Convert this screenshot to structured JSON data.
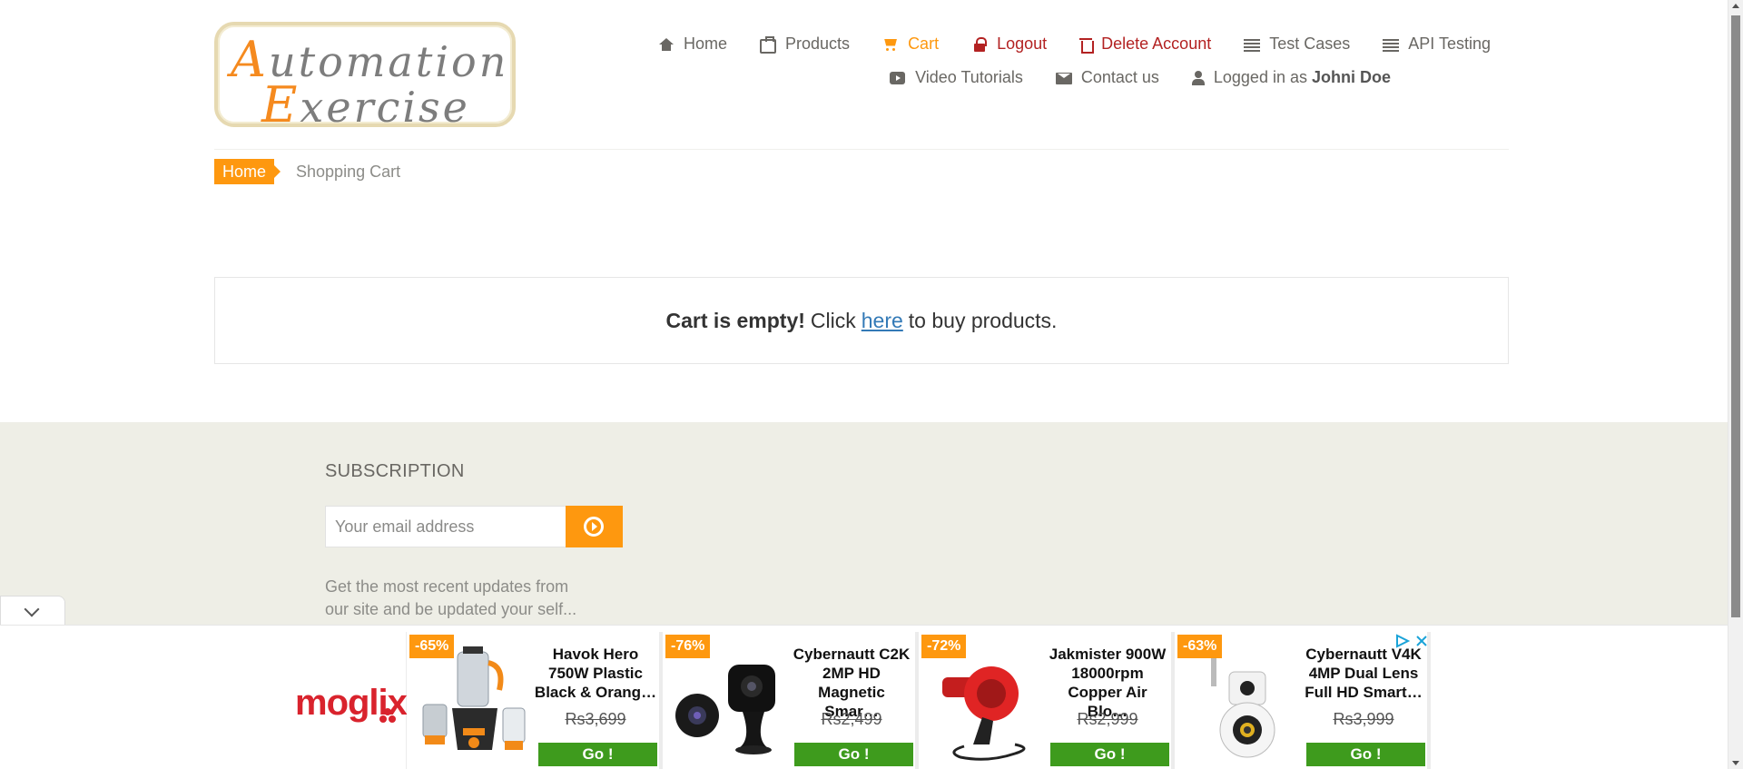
{
  "logo": {
    "line1_cap": "A",
    "line1_rest": "utomation",
    "line2_cap": "E",
    "line2_rest": "xercise"
  },
  "nav": {
    "row1": [
      {
        "label": "Home",
        "icon": "home-icon"
      },
      {
        "label": "Products",
        "icon": "briefcase-icon"
      },
      {
        "label": "Cart",
        "icon": "shopping-cart-icon"
      },
      {
        "label": "Logout",
        "icon": "lock-icon"
      },
      {
        "label": "Delete Account",
        "icon": "trash-icon"
      },
      {
        "label": "Test Cases",
        "icon": "list-icon"
      },
      {
        "label": "API Testing",
        "icon": "list-icon"
      }
    ],
    "row2": [
      {
        "label": "Video Tutorials",
        "icon": "youtube-play-icon"
      },
      {
        "label": "Contact us",
        "icon": "envelope-icon"
      },
      {
        "label": "Logged in as",
        "icon": "user-icon",
        "username": "Johni Doe"
      }
    ]
  },
  "breadcrumb": {
    "home": "Home",
    "current": "Shopping Cart"
  },
  "cart": {
    "empty_bold": "Cart is empty!",
    "click": "Click",
    "link": "here",
    "rest": "to buy products."
  },
  "subscription": {
    "title": "SUBSCRIPTION",
    "placeholder": "Your email address",
    "description": "Get the most recent updates from our site and be updated your self..."
  },
  "ad": {
    "brand": "moglix",
    "go_label": "Go !",
    "cards": [
      {
        "discount": "-65%",
        "title": "Havok Hero 750W Plastic Black & Orang…",
        "price": "Rs3,699"
      },
      {
        "discount": "-76%",
        "title": "Cybernautt C2K 2MP HD Magnetic Smar…",
        "price": "Rs2,499"
      },
      {
        "discount": "-72%",
        "title": "Jakmister 900W 18000rpm Copper Air Blo…",
        "price": "Rs2,999"
      },
      {
        "discount": "-63%",
        "title": "Cybernautt V4K 4MP Dual Lens Full HD Smart…",
        "price": "Rs3,999"
      }
    ]
  },
  "colors": {
    "accent": "#FE980F",
    "danger": "#B32222",
    "link": "#337AB7",
    "go_button": "#3E9B1D",
    "footer_bg": "#EEEEE6"
  }
}
